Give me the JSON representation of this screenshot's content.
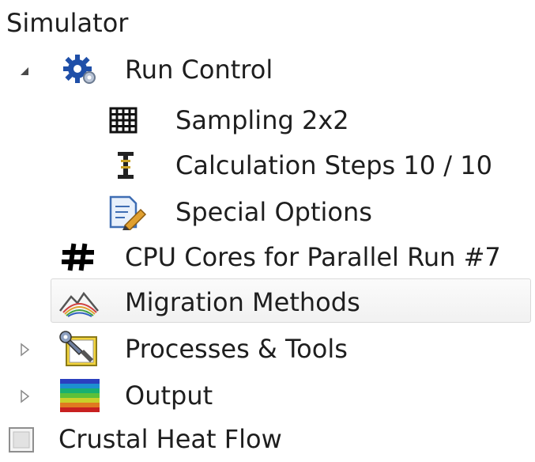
{
  "tree": {
    "root_label": "Simulator",
    "run_control": {
      "label": "Run Control",
      "icon": "gear-icon",
      "expanded": true,
      "children": [
        {
          "label": "Sampling 2x2",
          "icon": "grid-icon"
        },
        {
          "label": "Calculation Steps 10 / 10",
          "icon": "steps-icon"
        },
        {
          "label": "Special Options",
          "icon": "edit-document-icon"
        }
      ]
    },
    "cpu_cores": {
      "label": "CPU Cores for Parallel Run #7",
      "icon": "hash-icon"
    },
    "migration_methods": {
      "label": "Migration Methods",
      "icon": "migration-icon",
      "selected": true
    },
    "processes_tools": {
      "label": "Processes & Tools",
      "icon": "tools-icon",
      "expanded": false
    },
    "output": {
      "label": "Output",
      "icon": "output-layers-icon",
      "expanded": false
    },
    "crustal_heat_flow": {
      "label": "Crustal Heat Flow",
      "icon": "checkbox-icon",
      "checked": false
    }
  },
  "colors": {
    "selection_border": "#d9d9d9",
    "text": "#1e1e1e",
    "gear_blue": "#1f4fa8"
  }
}
